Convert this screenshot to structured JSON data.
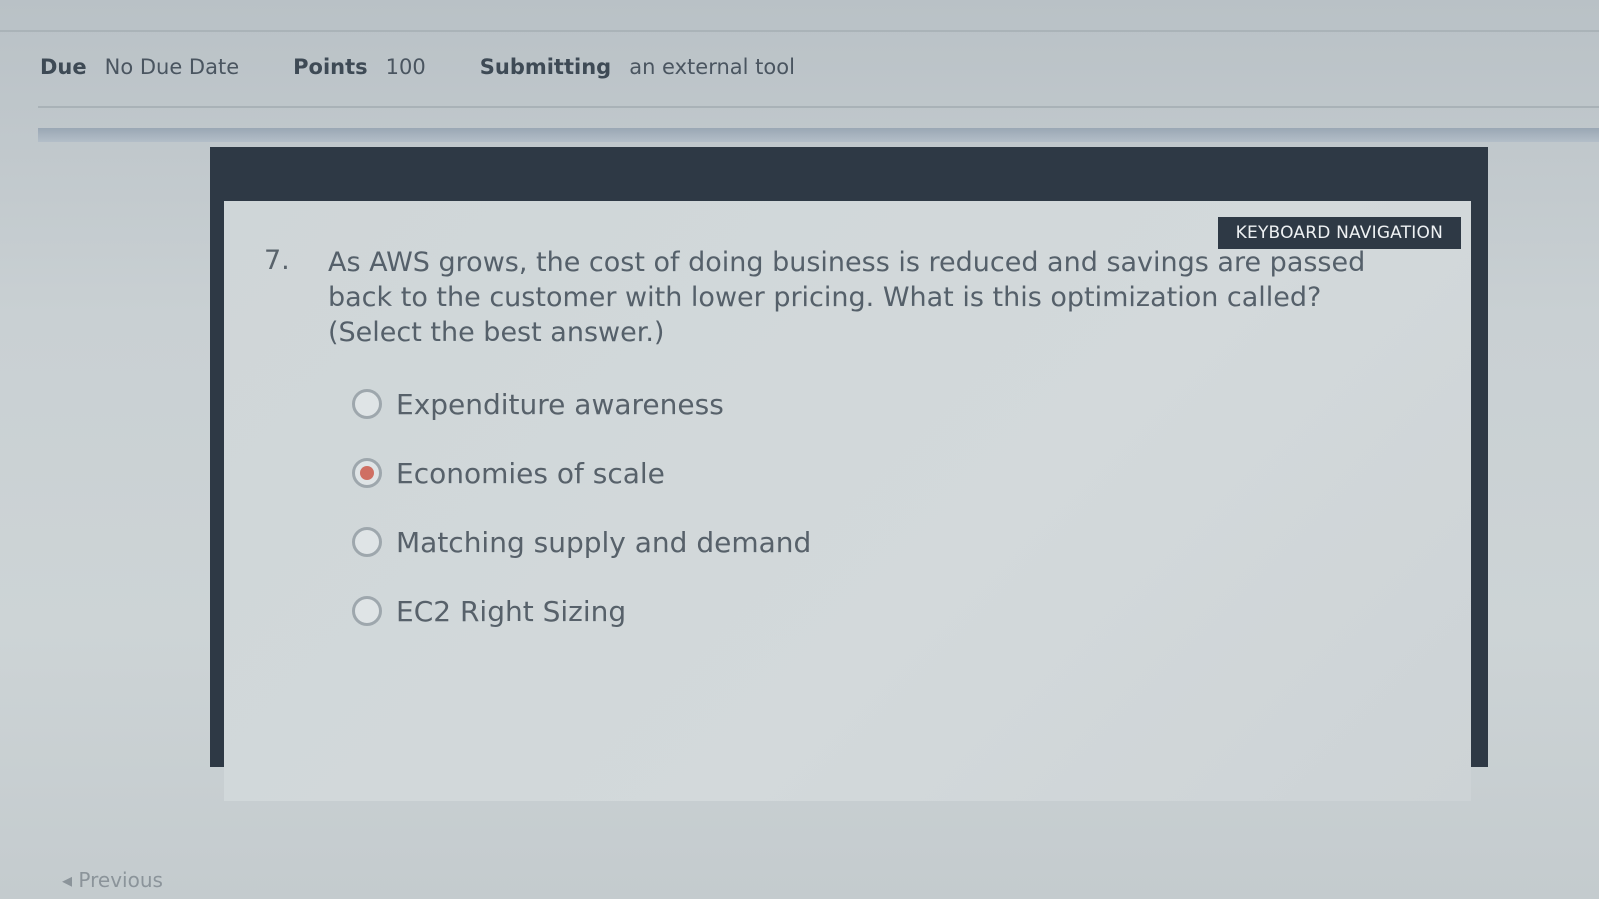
{
  "details": {
    "due_label": "Due",
    "due_value": "No Due Date",
    "points_label": "Points",
    "points_value": "100",
    "submitting_label": "Submitting",
    "submitting_value": "an external tool"
  },
  "quiz": {
    "keyboard_nav": "KEYBOARD NAVIGATION",
    "question_number": "7.",
    "question_text": "As AWS grows, the cost of doing business is reduced and savings are passed back to the customer with lower pricing. What is this optimization called? (Select the best answer.)",
    "answers": [
      {
        "label": "Expenditure awareness",
        "selected": false
      },
      {
        "label": "Economies of scale",
        "selected": true
      },
      {
        "label": "Matching supply and demand",
        "selected": false
      },
      {
        "label": "EC2 Right Sizing",
        "selected": false
      }
    ],
    "selected_color": "#cf6f63"
  },
  "nav": {
    "previous_label": "◂ Previous"
  }
}
